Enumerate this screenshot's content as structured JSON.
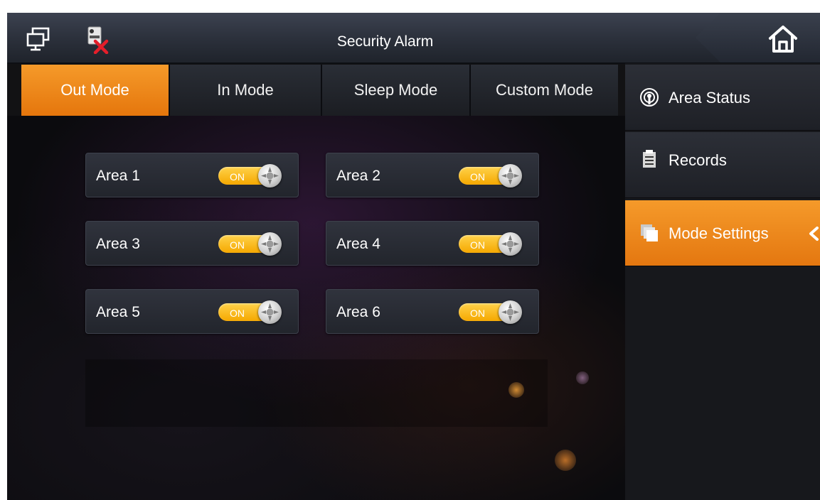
{
  "title_bar": {
    "title": "Security Alarm",
    "icons": [
      "network-monitor-icon",
      "camera-disconnected-icon",
      "home-icon"
    ]
  },
  "tabs": [
    {
      "label": "Out Mode",
      "active": true
    },
    {
      "label": "In Mode",
      "active": false
    },
    {
      "label": "Sleep Mode",
      "active": false
    },
    {
      "label": "Custom Mode",
      "active": false
    }
  ],
  "areas": [
    {
      "label": "Area 1",
      "toggle": "ON"
    },
    {
      "label": "Area 2",
      "toggle": "ON"
    },
    {
      "label": "Area 3",
      "toggle": "ON"
    },
    {
      "label": "Area 4",
      "toggle": "ON"
    },
    {
      "label": "Area 5",
      "toggle": "ON"
    },
    {
      "label": "Area 6",
      "toggle": "ON"
    }
  ],
  "side_menu": [
    {
      "label": "Area Status",
      "icon": "area-status-icon",
      "active": false
    },
    {
      "label": "Records",
      "icon": "records-icon",
      "active": false
    },
    {
      "label": "Mode Settings",
      "icon": "mode-settings-icon",
      "active": true
    }
  ],
  "colors": {
    "accent": "#f0891c",
    "toggle_on": "#f8bb10",
    "background": "#121214"
  }
}
